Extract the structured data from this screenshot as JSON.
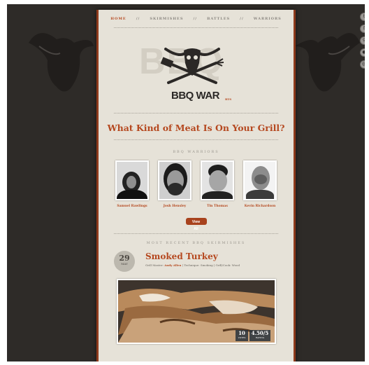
{
  "nav": {
    "items": [
      "Home",
      "Skirmishes",
      "Battles",
      "Warriors"
    ],
    "separators": [
      "//",
      "//",
      "//"
    ]
  },
  "social_icons": [
    "twitter-icon",
    "facebook-icon",
    "search-icon",
    "rss-icon",
    "email-icon"
  ],
  "logo": {
    "background_letters": "BBQ",
    "text": "BBQ WAR",
    "superscript": "RTS"
  },
  "headline": "What Kind of Meat Is On Your Grill?",
  "warriors_section": {
    "title": "BBQ Warriors",
    "warriors": [
      {
        "name": "Samuel Rawlings"
      },
      {
        "name": "Josh Hensley"
      },
      {
        "name": "Tin Thomas"
      },
      {
        "name": "Kevin Richardson"
      }
    ],
    "view_all_label": "View All"
  },
  "recent_section": {
    "title": "Most Recent BBQ Skirmishes",
    "post": {
      "day": "29",
      "month": "May",
      "title": "Smoked Turkey",
      "meta_grill_label": "Grill Master:",
      "meta_grill_value": "Andy Allen",
      "meta_technique_label": "Technique:",
      "meta_technique_value": "Smoking",
      "meta_cook_label": "Grill/Cook:",
      "meta_cook_value": "Wood",
      "stat_votes_value": "10",
      "stat_votes_label": "Votes",
      "stat_rating_value": "4.50/5",
      "stat_rating_label": "Rating"
    }
  },
  "colors": {
    "accent": "#b5481f",
    "paper": "#e6e2d8",
    "background": "#2e2b28"
  }
}
